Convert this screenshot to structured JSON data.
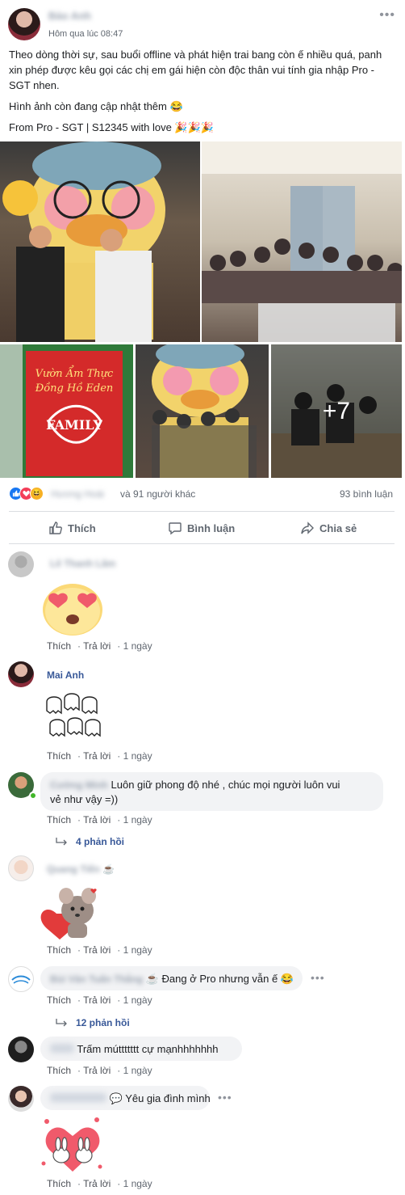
{
  "post": {
    "author": "Bảo Anh",
    "time": "Hôm qua lúc 08:47",
    "text1": "Theo dòng thời sự, sau buổi offline và phát hiện trai bang còn ế nhiều quá, panh xin phép được kêu gọi các chị em gái hiện còn độc thân vui tính gia nhập Pro - SGT nhen.",
    "text2": "Hình ảnh còn đang cập nhật thêm 😂",
    "text3": "From Pro - SGT | S12345 with love 🎉🎉🎉",
    "more_photos": "+7"
  },
  "reactions": {
    "names": "Hương Hoài",
    "others": "và 91 người khác",
    "comments": "93 bình luận"
  },
  "actions": {
    "like": "Thích",
    "comment": "Bình luận",
    "share": "Chia sẻ"
  },
  "comment_actions": {
    "like": "Thích",
    "reply": "Trả lời",
    "age": "1 ngày"
  },
  "comments": [
    {
      "name": "Lê Thanh Lâm"
    },
    {
      "name": "Mai Anh"
    },
    {
      "name": "Cường Minh",
      "text": "Luôn giữ phong độ nhé , chúc mọi người luôn vui",
      "text_b": "vẻ như vậy =))",
      "replies": "4 phản hồi"
    },
    {
      "name": "Quang Tiến",
      "suffix": "☕"
    },
    {
      "name": "Bùi Văn Tuấn Thắng",
      "suffix": "☕ Đang ở Pro nhưng vẫn ế 😂",
      "replies": "12 phản hồi"
    },
    {
      "name": "Đỗ Huy",
      "text": "Trấm múttttttt cự mạnhhhhhhh"
    },
    {
      "name": "Hồng Nhung",
      "text": "💬 Yêu gia đình mình"
    }
  ]
}
